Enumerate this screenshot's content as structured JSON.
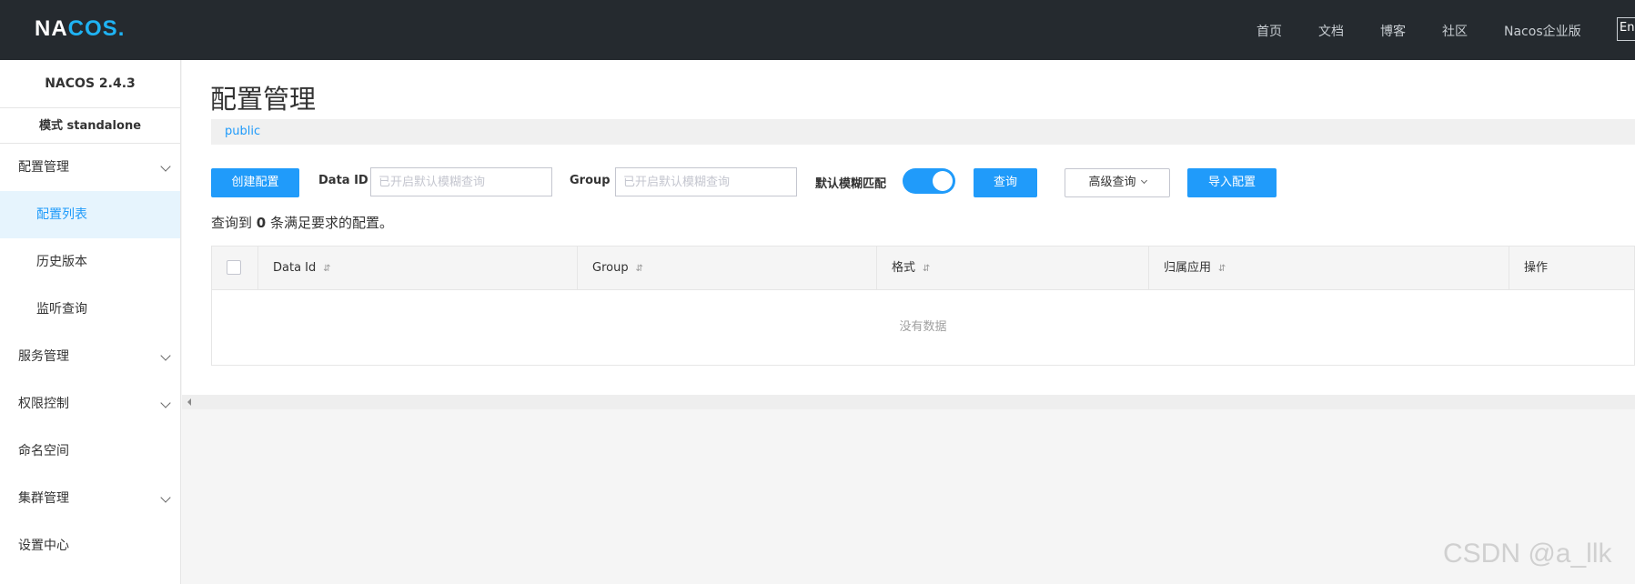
{
  "header": {
    "logo_text_1": "NA",
    "logo_text_2": "COS",
    "logo_dot": ".",
    "nav": [
      "首页",
      "文档",
      "博客",
      "社区",
      "Nacos企业版"
    ],
    "lang": "En"
  },
  "sidebar": {
    "version": "NACOS 2.4.3",
    "mode": "模式 standalone",
    "items": [
      {
        "label": "配置管理",
        "expandable": true
      },
      {
        "label": "配置列表",
        "sub": true,
        "active": true
      },
      {
        "label": "历史版本",
        "sub": true
      },
      {
        "label": "监听查询",
        "sub": true
      },
      {
        "label": "服务管理",
        "expandable": true
      },
      {
        "label": "权限控制",
        "expandable": true
      },
      {
        "label": "命名空间"
      },
      {
        "label": "集群管理",
        "expandable": true
      },
      {
        "label": "设置中心"
      }
    ]
  },
  "main": {
    "title": "配置管理",
    "namespace": "public",
    "toolbar": {
      "create_label": "创建配置",
      "dataid_label": "Data ID",
      "dataid_placeholder": "已开启默认模糊查询",
      "group_label": "Group",
      "group_placeholder": "已开启默认模糊查询",
      "fuzzy_label": "默认模糊匹配",
      "fuzzy_on": true,
      "query_label": "查询",
      "advanced_label": "高级查询",
      "import_label": "导入配置"
    },
    "result": {
      "prefix": "查询到",
      "count": "0",
      "suffix": "条满足要求的配置。"
    },
    "table": {
      "columns": [
        "Data Id",
        "Group",
        "格式",
        "归属应用",
        "操作"
      ],
      "sort_icon": "⇵",
      "empty_text": "没有数据"
    }
  },
  "watermark": "CSDN @a_llk",
  "colors": {
    "header_bg": "#252a2f",
    "primary": "#209bfa",
    "active_bg": "#e6f4fd"
  }
}
